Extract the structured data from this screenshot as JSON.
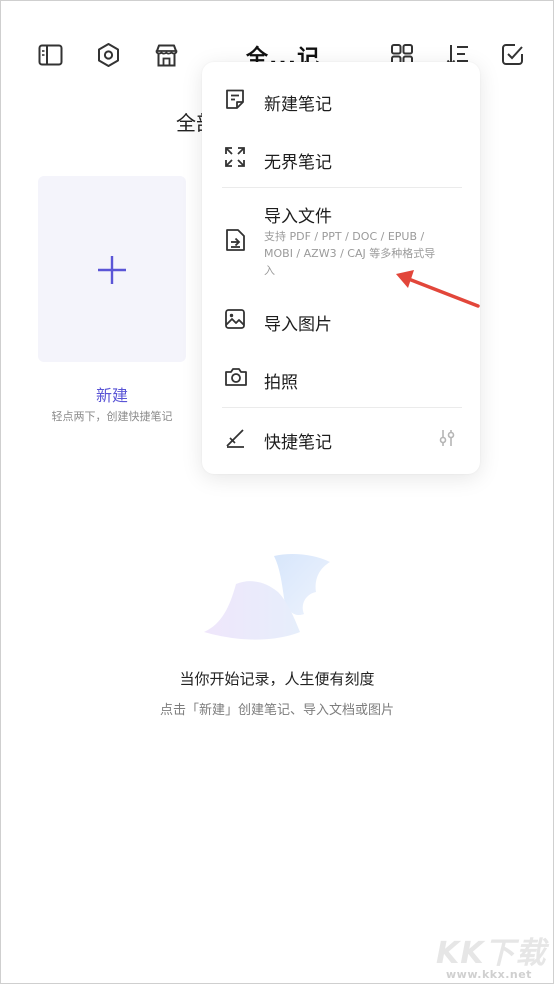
{
  "header": {
    "title": "全...记",
    "icons": [
      "sidebar-icon",
      "settings-icon",
      "store-icon",
      "grid-view-icon",
      "sort-icon",
      "select-icon"
    ]
  },
  "section_title": "全部",
  "new_card": {
    "label": "新建",
    "hint": "轻点两下，创建快捷笔记"
  },
  "empty_state": {
    "title": "当你开始记录，人生便有刻度",
    "subtitle": "点击「新建」创建笔记、导入文档或图片"
  },
  "menu": {
    "items": [
      {
        "label": "新建笔记",
        "icon": "new-note-icon"
      },
      {
        "label": "无界笔记",
        "icon": "expand-icon"
      },
      {
        "label": "导入文件",
        "icon": "import-file-icon",
        "desc": "支持 PDF / PPT / DOC / EPUB / MOBI / AZW3 / CAJ 等多种格式导入"
      },
      {
        "label": "导入图片",
        "icon": "image-icon"
      },
      {
        "label": "拍照",
        "icon": "camera-icon"
      },
      {
        "label": "快捷笔记",
        "icon": "quick-note-icon",
        "trailing_icon": "sliders-icon"
      }
    ]
  },
  "watermark": {
    "text": "KK下载",
    "url": "www.kkx.net"
  },
  "colors": {
    "accent": "#5a55d6",
    "card_bg": "#f4f4fb",
    "arrow": "#e2463a"
  }
}
